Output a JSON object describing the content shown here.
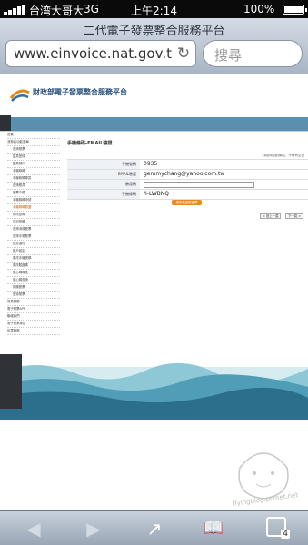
{
  "status": {
    "carrier": "台湾大哥大",
    "network": "3G",
    "time": "上午2:14",
    "battery": "100%"
  },
  "browser": {
    "page_title": "二代電子發票整合服務平台",
    "url": "www.einvoice.nat.gov.tw",
    "search_placeholder": "搜尋"
  },
  "site": {
    "agency": "財政部電子發票整合服務平台"
  },
  "form": {
    "title": "手機條碼-EMAIL驗證",
    "note": "*為必填(選)欄位，不得有空白",
    "phone_label": "手機號碼",
    "phone_value": "0935",
    "email_label": "EMAIL驗證",
    "email_value": "gemmychang@yahoo.com.tw",
    "code_label": "驗證碼",
    "barcode_label": "手機條碼",
    "barcode_value": "/I-LWBNQ",
    "submit_label": "重新發送驗證碼",
    "prev_label": "< 回上一頁",
    "next_label": "下一頁 >"
  },
  "sidebar": {
    "items": [
      "首頁",
      "消費者功能選單",
      "查詢發票",
      "載具登錄",
      "載具歸戶",
      "手機條碼",
      "手機條碼專區",
      "查詢應具",
      "發票中獎",
      "手機條碼申請",
      "手機條碼驗證",
      "修改密碼",
      "忘記密碼",
      "查詢消費發票",
      "查詢中獎發票",
      "設定通知",
      "帳戶設定",
      "更改手機號碼",
      "更改驗證碼",
      "愛心碼專區",
      "愛心碼查詢",
      "捐贈發票",
      "登錄發票",
      "常見問題",
      "電子發票APP",
      "聯絡我們",
      "電子發票專區",
      "民眾服務"
    ]
  },
  "toolbar": {
    "back": "◀",
    "forward": "▶",
    "share": "↗",
    "bookmarks": "📖",
    "tabs_count": "4"
  },
  "watermark": {
    "text": "flyingblog.pixnet.net"
  }
}
